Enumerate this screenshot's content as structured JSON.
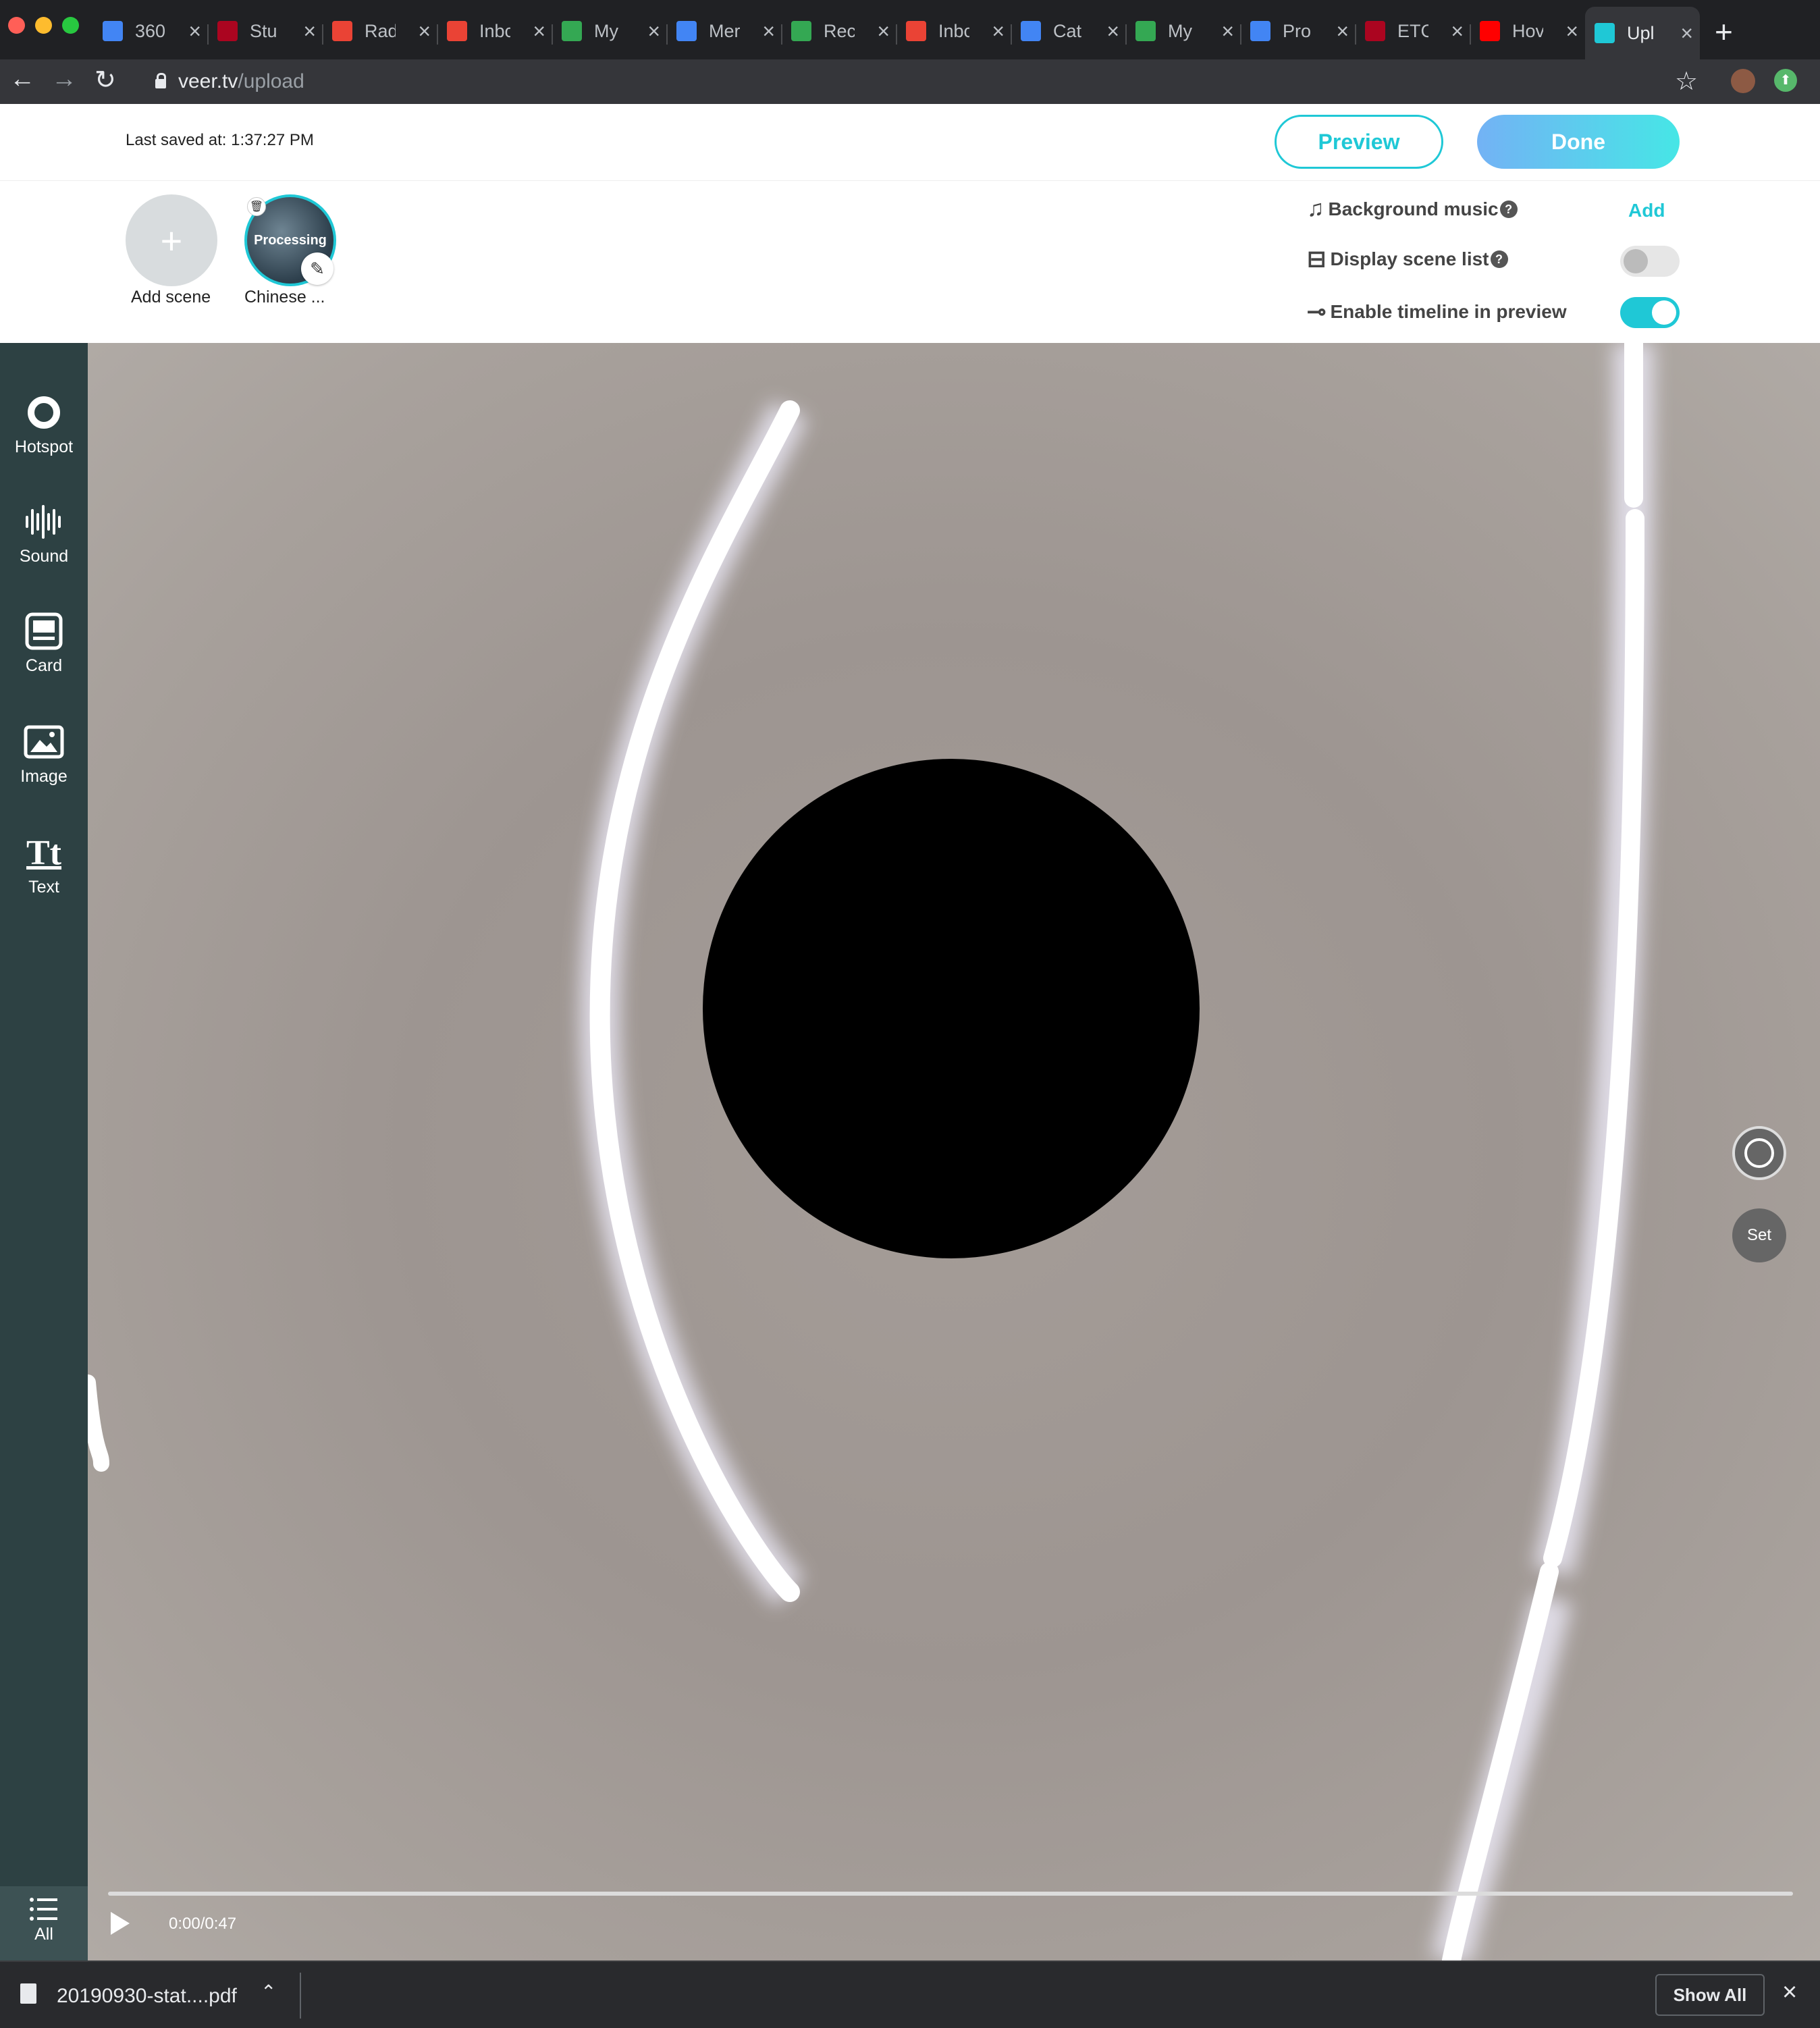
{
  "browser": {
    "tabs": [
      {
        "title": "360",
        "icon": "google-docs-icon",
        "color": "#4285f4"
      },
      {
        "title": "Stu",
        "icon": "university-logo-icon",
        "color": "#ab0520"
      },
      {
        "title": "Rad",
        "icon": "gmail-icon",
        "color": "#ea4335"
      },
      {
        "title": "Inbc",
        "icon": "gmail-icon",
        "color": "#ea4335"
      },
      {
        "title": "My",
        "icon": "google-drive-icon",
        "color": "#34a853"
      },
      {
        "title": "Mer",
        "icon": "google-docs-icon",
        "color": "#4285f4"
      },
      {
        "title": "Rec",
        "icon": "google-drive-icon",
        "color": "#34a853"
      },
      {
        "title": "Inbc",
        "icon": "gmail-icon",
        "color": "#ea4335"
      },
      {
        "title": "Cat",
        "icon": "google-docs-icon",
        "color": "#4285f4"
      },
      {
        "title": "My",
        "icon": "google-drive-icon",
        "color": "#34a853"
      },
      {
        "title": "Pro",
        "icon": "google-docs-icon",
        "color": "#4285f4"
      },
      {
        "title": "ETC",
        "icon": "university-logo-icon",
        "color": "#ab0520"
      },
      {
        "title": "Hov",
        "icon": "youtube-icon",
        "color": "#ff0000"
      },
      {
        "title": "Upl",
        "icon": "veer-icon",
        "color": "#1fc8d6",
        "active": true
      }
    ],
    "url_host": "veer.tv",
    "url_path": "/upload"
  },
  "header": {
    "last_saved": "Last saved at: 1:37:27 PM",
    "preview_label": "Preview",
    "done_label": "Done"
  },
  "scenes": {
    "add_label": "Add scene",
    "add_symbol": "+",
    "items": [
      {
        "name": "Chinese ...",
        "status": "Processing"
      }
    ]
  },
  "settings": {
    "background_music": {
      "label": "Background music",
      "action": "Add"
    },
    "display_scene_list": {
      "label": "Display scene list",
      "enabled": false
    },
    "enable_timeline": {
      "label": "Enable timeline in preview",
      "enabled": true
    },
    "help_symbol": "?"
  },
  "tools": [
    {
      "label": "Hotspot",
      "icon": "hotspot-icon"
    },
    {
      "label": "Sound",
      "icon": "sound-icon"
    },
    {
      "label": "Card",
      "icon": "card-icon"
    },
    {
      "label": "Image",
      "icon": "image-icon"
    },
    {
      "label": "Text",
      "icon": "text-icon"
    }
  ],
  "text_icon_glyph": "Tt",
  "all_label": "All",
  "player": {
    "time": "0:00/0:47",
    "set_label": "Set"
  },
  "downloads": {
    "file": "20190930-stat....pdf",
    "show_all": "Show All"
  },
  "colors": {
    "accent": "#1fc8d6",
    "sidebar": "#2d4143",
    "toggle_off": "#e6e6e6"
  }
}
